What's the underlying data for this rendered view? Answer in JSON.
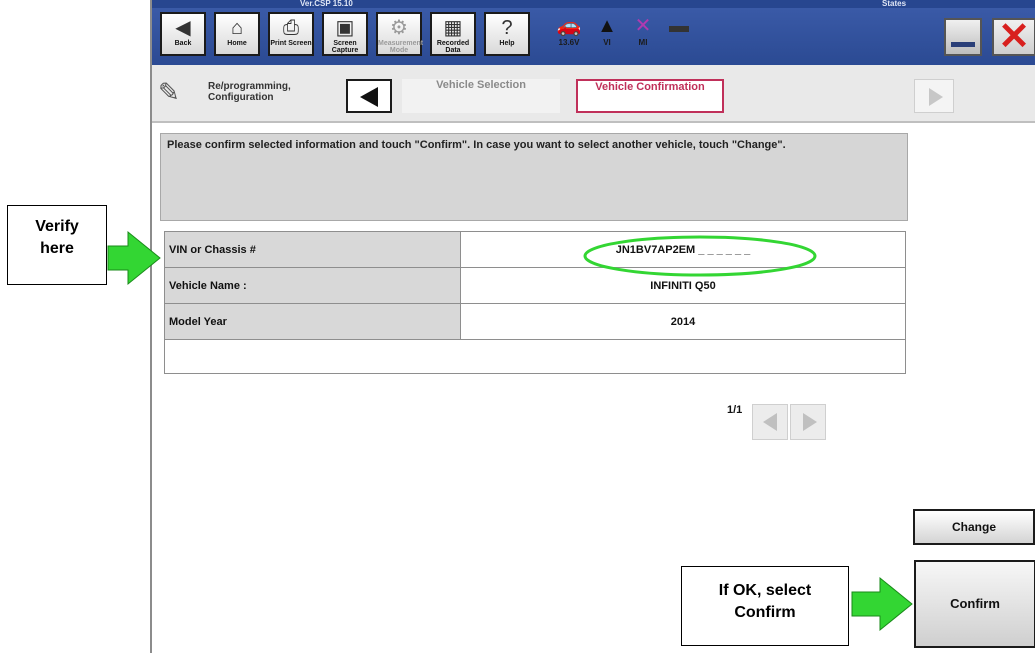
{
  "titlebar": {
    "version": "Ver.CSP 15.10",
    "state": "States"
  },
  "toolbar": {
    "buttons": [
      {
        "label": "Back",
        "icon": "back-arrow-icon"
      },
      {
        "label": "Home",
        "icon": "home-icon"
      },
      {
        "label": "Print Screen",
        "icon": "printer-icon"
      },
      {
        "label": "Screen Capture",
        "icon": "camera-icon"
      },
      {
        "label": "Measurement Mode",
        "icon": "measurement-icon"
      },
      {
        "label": "Recorded Data",
        "icon": "recorded-data-icon"
      },
      {
        "label": "Help",
        "icon": "help-icon"
      }
    ],
    "status": [
      {
        "label": "13.6V",
        "icon": "car-battery-icon"
      },
      {
        "label": "VI",
        "icon": "signal-icon"
      },
      {
        "label": "MI",
        "icon": "mi-cross-icon"
      }
    ]
  },
  "nav": {
    "section_label": "Re/programming, Configuration",
    "step1": "Vehicle Selection",
    "step2": "Vehicle Confirmation"
  },
  "instruction": "Please confirm selected information and touch \"Confirm\". In case you want to select another vehicle, touch \"Change\".",
  "vehicle_table": {
    "rows": [
      {
        "label": "VIN or Chassis #",
        "value": "JN1BV7AP2EM _ _ _ _ _ _"
      },
      {
        "label": "Vehicle Name :",
        "value": "INFINITI Q50"
      },
      {
        "label": "Model Year",
        "value": "2014"
      }
    ]
  },
  "pager": {
    "text": "1/1"
  },
  "actions": {
    "change": "Change",
    "confirm": "Confirm"
  },
  "annotations": {
    "verify_line1": "Verify",
    "verify_line2": "here",
    "ok_line1": "If OK, select",
    "ok_line2": "Confirm"
  },
  "colors": {
    "accent": "#c0305a",
    "arrow": "#33d633",
    "toolbar": "#2b4a93",
    "highlight": "#33d633"
  }
}
